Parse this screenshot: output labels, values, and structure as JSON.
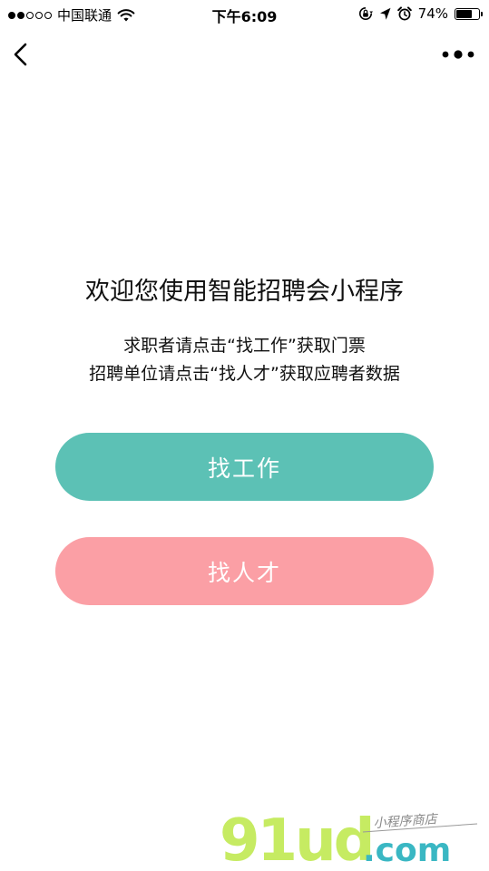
{
  "status_bar": {
    "carrier": "中国联通",
    "time": "下午6:09",
    "battery_text": "74%",
    "battery_level": 0.74,
    "signal_bars_filled": 2,
    "signal_bars_total": 5
  },
  "nav": {
    "back_icon": "chevron-left-icon",
    "more_icon": "more-dots-icon"
  },
  "main": {
    "title": "欢迎您使用智能招聘会小程序",
    "instruction_line1": "求职者请点击“找工作”获取门票",
    "instruction_line2": "招聘单位请点击“找人才”获取应聘者数据",
    "find_job_label": "找工作",
    "find_talent_label": "找人才"
  },
  "watermark": {
    "brand": "91ud",
    "domain": ".com",
    "tagline": "小程序商店"
  },
  "colors": {
    "find_job_button": "#5cc1b5",
    "find_talent_button": "#fb9fa5",
    "watermark_green": "#c6eb62",
    "watermark_teal": "#3ab7c3"
  }
}
